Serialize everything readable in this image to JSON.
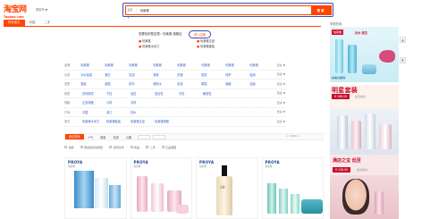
{
  "header": {
    "logo_cn": "淘宝网",
    "logo_en": "Taobao.com",
    "region": "重庆市 ▼"
  },
  "search": {
    "scope": "宝贝 ▼",
    "value": "珀莱雅",
    "button": "搜 索"
  },
  "tabs": [
    {
      "label": "所有宝贝"
    },
    {
      "label": "天猫"
    },
    {
      "label": "二手"
    }
  ],
  "tip": {
    "text": "您要找的是否是：珀莱雅 旗舰店",
    "button": "进入店铺"
  },
  "recommend": [
    "珀莱雅",
    "珀莱雅正品",
    "珀莱雅水动力",
    "珀莱雅套装"
  ],
  "attributes": [
    {
      "label": "品牌",
      "values": [
        "珀莱雅",
        "珀莱雅",
        "珀莱雅",
        "珀莱雅",
        "珀莱雅",
        "珀莱雅",
        "珀莱雅",
        "珀莱雅"
      ],
      "more": "更多 ▼"
    },
    {
      "label": "功效",
      "values": [
        "补水保湿",
        "美白",
        "控油",
        "紧致",
        "抗皱",
        "提亮",
        "修护",
        "滋润"
      ],
      "more": "更多 ▼"
    },
    {
      "label": "类型",
      "values": [
        "套装",
        "面霜",
        "精华",
        "爽肤水",
        "乳液",
        "眼霜",
        "面膜",
        "洁面"
      ],
      "more": "更多 ▼"
    },
    {
      "label": "肤质",
      "values": [
        "任何肤质",
        "干性",
        "油性",
        "混合性",
        "中性",
        "敏感性",
        "",
        ""
      ],
      "more": "更多 ▼"
    },
    {
      "label": "规格",
      "values": [
        "正常规格",
        "小样",
        "中样",
        "",
        "",
        "",
        "",
        ""
      ],
      "more": "更多 ▼"
    },
    {
      "label": "产地",
      "values": [
        "中国",
        "浙江",
        "杭州",
        "",
        "",
        "",
        "",
        ""
      ],
      "more": "更多 ▼"
    },
    {
      "label": "相关",
      "values": [
        "珀莱雅水动力",
        "珀莱雅套装",
        "珀莱雅正品",
        "珀莱雅旗舰",
        "",
        "",
        "",
        ""
      ],
      "more": "更多 ▼"
    }
  ],
  "sort": {
    "items": [
      "综合排序",
      "人气",
      "销量",
      "信用",
      "价格"
    ],
    "pager": "< 1/100 >"
  },
  "options": [
    "包邮",
    "赠送退货运费险",
    "货到付款",
    "新品",
    "二手",
    "正品保障"
  ],
  "products": [
    {
      "brand": "PROYA",
      "sub": "珀莱雅"
    },
    {
      "brand": "PROYA",
      "sub": "珀莱雅"
    },
    {
      "brand": "PROYA",
      "sub": "珀莱雅"
    },
    {
      "brand": "PROYA",
      "sub": "珀莱雅"
    }
  ],
  "side": {
    "title": "掌柜热卖",
    "ad1_badge": "珀莱雅",
    "ad1_text": "补水·美白",
    "ad1_caption": "水动力系列",
    "ad2_head": "明星套装",
    "ad2_price": "¥ 186.00",
    "ad2_sales": "最近成交",
    "ad4_text": "满店之宝 低至",
    "ad4_price": "¥ 158.00",
    "ad4_sales": "最近成交"
  },
  "scroll": {
    "up": "▲",
    "down": "▼"
  }
}
